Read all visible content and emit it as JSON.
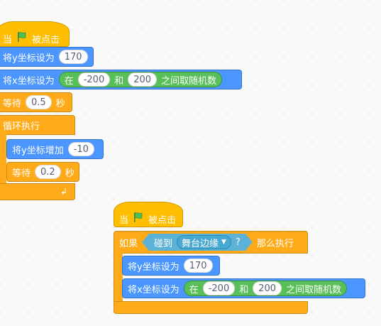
{
  "script1": {
    "hat": {
      "when": "当",
      "flag_icon": "green-flag-icon",
      "clicked": "被点击"
    },
    "set_y": {
      "label": "将y坐标设为",
      "value": "170"
    },
    "set_x": {
      "label": "将x坐标设为",
      "random": {
        "in": "在",
        "from": "-200",
        "and": "和",
        "to": "200",
        "suffix": "之间取随机数"
      }
    },
    "wait1": {
      "label": "等待",
      "value": "0.5",
      "unit": "秒"
    },
    "forever": {
      "label": "循环执行",
      "loop_icon": "loop-arrow-icon"
    },
    "change_y": {
      "label": "将y坐标增加",
      "value": "-10"
    },
    "wait2": {
      "label": "等待",
      "value": "0.2",
      "unit": "秒"
    }
  },
  "script2": {
    "hat": {
      "when": "当",
      "flag_icon": "green-flag-icon",
      "clicked": "被点击"
    },
    "if_block": {
      "if": "如果",
      "touching": "碰到",
      "target": "舞台边缘",
      "question": "?",
      "then": "那么执行"
    },
    "set_y": {
      "label": "将y坐标设为",
      "value": "170"
    },
    "set_x": {
      "label": "将x坐标设为",
      "random": {
        "in": "在",
        "from": "-200",
        "and": "和",
        "to": "200",
        "suffix": "之间取随机数"
      }
    }
  },
  "colors": {
    "motion": "#4c97ff",
    "event": "#ffbf00",
    "control": "#ffab19",
    "sensing": "#5cb1d6",
    "operators": "#59c059",
    "flag": "#4cbf56"
  }
}
